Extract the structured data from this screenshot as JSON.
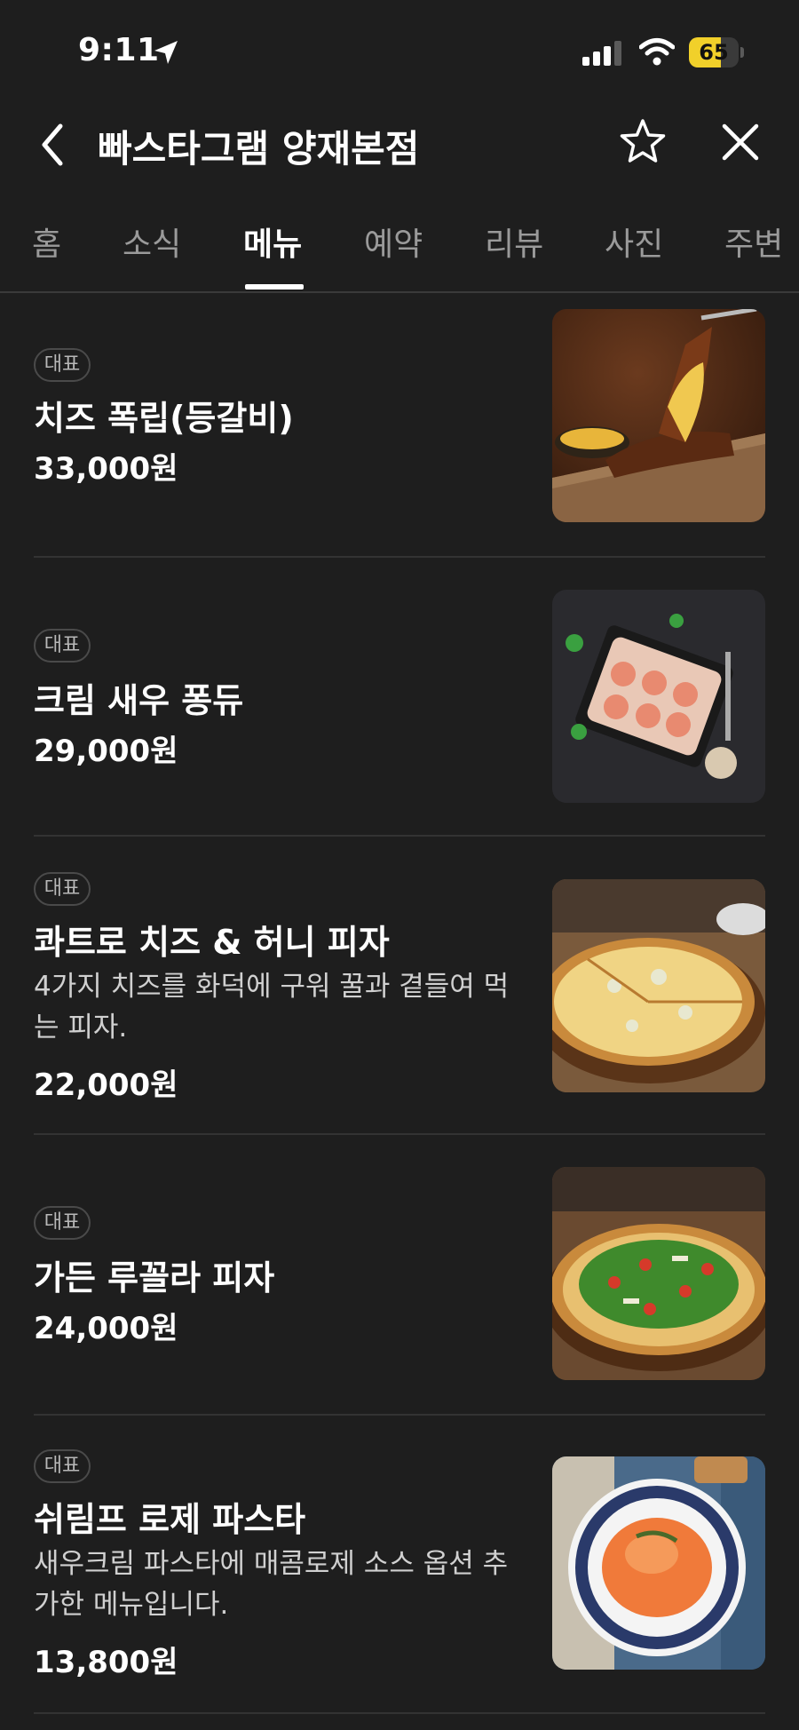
{
  "status_bar": {
    "time": "9:11",
    "battery_level": "65",
    "battery_fraction": 0.65
  },
  "header": {
    "title": "빠스타그램 양재본점"
  },
  "tabs": [
    {
      "label": "홈",
      "active": false
    },
    {
      "label": "소식",
      "active": false
    },
    {
      "label": "메뉴",
      "active": true
    },
    {
      "label": "예약",
      "active": false
    },
    {
      "label": "리뷰",
      "active": false
    },
    {
      "label": "사진",
      "active": false
    },
    {
      "label": "주변",
      "active": false
    }
  ],
  "menu": {
    "items": [
      {
        "badge": "대표",
        "name": "치즈 폭립(등갈비)",
        "description": "",
        "price": "33,000원",
        "photo_icon": "ribs-photo"
      },
      {
        "badge": "대표",
        "name": "크림 새우 퐁듀",
        "description": "",
        "price": "29,000원",
        "photo_icon": "shrimp-fondue-photo"
      },
      {
        "badge": "대표",
        "name": "콰트로 치즈 & 허니 피자",
        "description": "4가지 치즈를 화덕에 구워 꿀과 곁들여 먹는 피자.",
        "price": "22,000원",
        "photo_icon": "cheese-pizza-photo"
      },
      {
        "badge": "대표",
        "name": "가든 루꼴라 피자",
        "description": "",
        "price": "24,000원",
        "photo_icon": "arugula-pizza-photo"
      },
      {
        "badge": "대표",
        "name": "쉬림프 로제 파스타",
        "description": "새우크림 파스타에 매콤로제 소스 옵션 추가한 메뉴입니다.",
        "price": "13,800원",
        "photo_icon": "rose-pasta-photo"
      }
    ]
  },
  "colors": {
    "background": "#1e1e1e",
    "accent_battery": "#f1d02a",
    "tab_inactive": "#9a9a9a"
  }
}
